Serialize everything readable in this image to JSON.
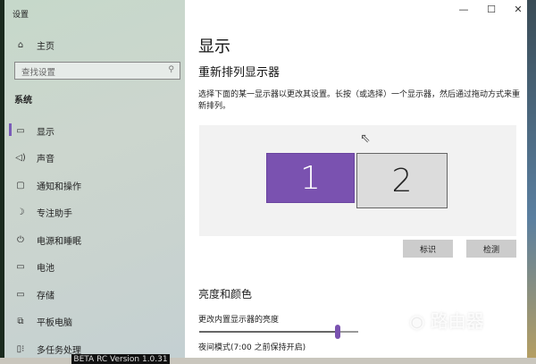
{
  "app_title": "设置",
  "window_controls": {
    "minimize": "—",
    "maximize": "☐",
    "close": "✕"
  },
  "sidebar": {
    "home": "主页",
    "search_placeholder": "查找设置",
    "section": "系统",
    "items": [
      {
        "icon": "monitor-icon",
        "glyph": "▭",
        "label": "显示"
      },
      {
        "icon": "speaker-icon",
        "glyph": "◁)",
        "label": "声音"
      },
      {
        "icon": "notification-icon",
        "glyph": "▢",
        "label": "通知和操作"
      },
      {
        "icon": "moon-icon",
        "glyph": "☽",
        "label": "专注助手"
      },
      {
        "icon": "power-icon",
        "glyph": "⏻",
        "label": "电源和睡眠"
      },
      {
        "icon": "battery-icon",
        "glyph": "▭",
        "label": "电池"
      },
      {
        "icon": "storage-icon",
        "glyph": "▭",
        "label": "存储"
      },
      {
        "icon": "tablet-icon",
        "glyph": "⧉",
        "label": "平板电脑"
      },
      {
        "icon": "multitask-icon",
        "glyph": "▯⁝",
        "label": "多任务处理"
      }
    ]
  },
  "main": {
    "title": "显示",
    "arrange_heading": "重新排列显示器",
    "arrange_desc": "选择下面的某一显示器以更改其设置。长按（或选择）一个显示器，然后通过拖动方式来重新排列。",
    "monitors": [
      "1",
      "2"
    ],
    "identify": "标识",
    "detect": "检测",
    "brightness_heading": "亮度和颜色",
    "brightness_label": "更改内置显示器的亮度",
    "brightness_percent": 87,
    "night_mode": "夜间模式(7:00 之前保持开启)"
  },
  "taskbar_text": "BETA RC Version 1.0.31",
  "watermark": "路由器 luyouqi.com",
  "accent": "#7a52b0"
}
